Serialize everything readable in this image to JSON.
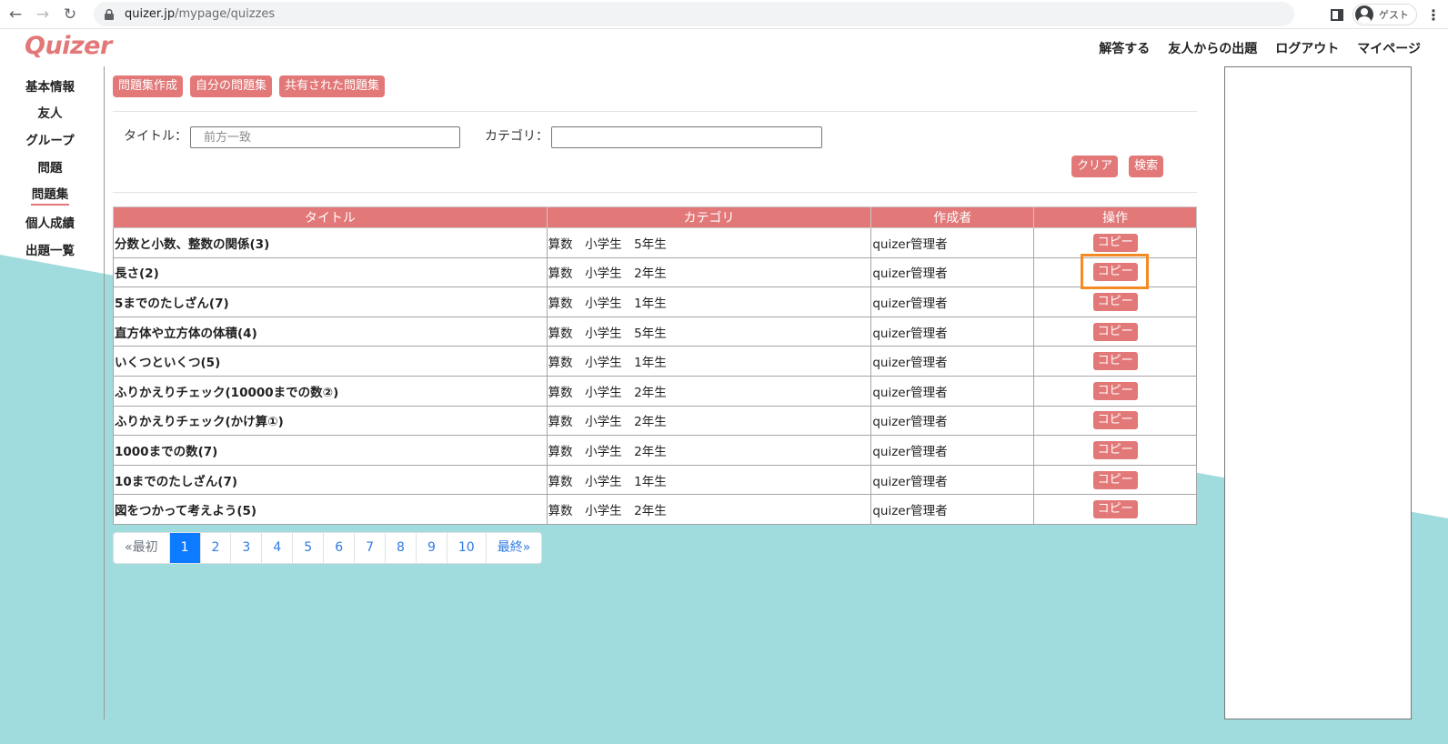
{
  "browser": {
    "url_host": "quizer.jp",
    "url_path": "/mypage/quizzes",
    "profile_label": "ゲスト"
  },
  "site": {
    "logo": "Quizer",
    "topnav": [
      "解答する",
      "友人からの出題",
      "ログアウト",
      "マイページ"
    ]
  },
  "sidebar": {
    "items": [
      {
        "label": "基本情報",
        "active": false
      },
      {
        "label": "友人",
        "active": false
      },
      {
        "label": "グループ",
        "active": false
      },
      {
        "label": "問題",
        "active": false
      },
      {
        "label": "問題集",
        "active": true
      },
      {
        "label": "個人成績",
        "active": false
      },
      {
        "label": "出題一覧",
        "active": false
      }
    ]
  },
  "toolbar": {
    "create_label": "問題集作成",
    "mine_label": "自分の問題集",
    "shared_label": "共有された問題集"
  },
  "search": {
    "title_label": "タイトル：",
    "title_value": "",
    "title_placeholder": "前方一致",
    "category_label": "カテゴリ：",
    "category_value": "",
    "clear_label": "クリア",
    "search_label": "検索"
  },
  "table": {
    "headers": [
      "タイトル",
      "カテゴリ",
      "作成者",
      "操作"
    ],
    "copy_label": "コピー",
    "rows": [
      {
        "title": "分数と小数、整数の関係(3)",
        "category": "算数　小学生　5年生",
        "author": "quizer管理者"
      },
      {
        "title": "長さ(2)",
        "category": "算数　小学生　2年生",
        "author": "quizer管理者"
      },
      {
        "title": "5までのたしざん(7)",
        "category": "算数　小学生　1年生",
        "author": "quizer管理者"
      },
      {
        "title": "直方体や立方体の体積(4)",
        "category": "算数　小学生　5年生",
        "author": "quizer管理者"
      },
      {
        "title": "いくつといくつ(5)",
        "category": "算数　小学生　1年生",
        "author": "quizer管理者"
      },
      {
        "title": "ふりかえりチェック(10000までの数②)",
        "category": "算数　小学生　2年生",
        "author": "quizer管理者"
      },
      {
        "title": "ふりかえりチェック(かけ算①)",
        "category": "算数　小学生　2年生",
        "author": "quizer管理者"
      },
      {
        "title": "1000までの数(7)",
        "category": "算数　小学生　2年生",
        "author": "quizer管理者"
      },
      {
        "title": "10までのたしざん(7)",
        "category": "算数　小学生　1年生",
        "author": "quizer管理者"
      },
      {
        "title": "図をつかって考えよう(5)",
        "category": "算数　小学生　2年生",
        "author": "quizer管理者"
      }
    ]
  },
  "pagination": {
    "first_label": "«最初",
    "pages": [
      "1",
      "2",
      "3",
      "4",
      "5",
      "6",
      "7",
      "8",
      "9",
      "10"
    ],
    "current": "1",
    "last_label": "最終»"
  },
  "colors": {
    "brand": "#e27878",
    "accent_highlight": "#f48a23",
    "teal_background": "#a0dbdd",
    "pagination_active": "#0d7bff"
  }
}
